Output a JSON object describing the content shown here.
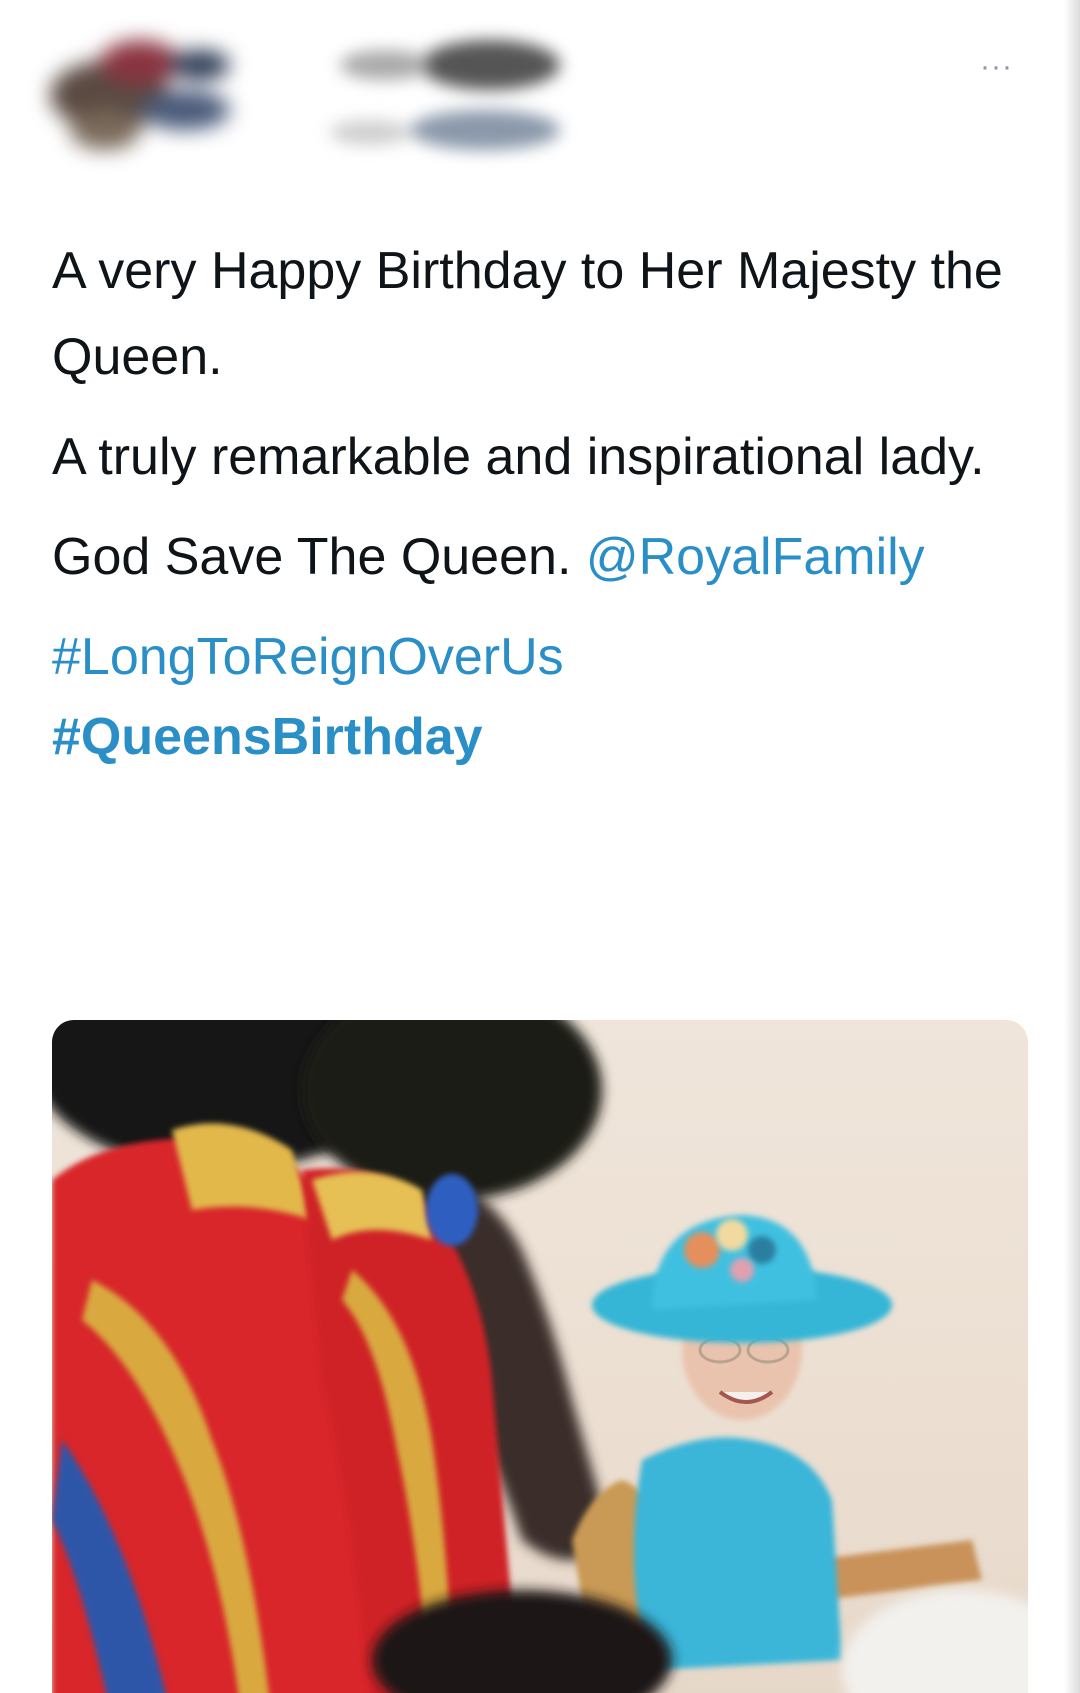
{
  "header": {
    "more_label": "···"
  },
  "tweet": {
    "line1": "A very Happy Birthday to Her Majesty the Queen.",
    "line2": "A truly remarkable and inspirational lady.",
    "line3_text": "God Save The Queen.",
    "mention": "@RoyalFamily",
    "hashtag1": "#LongToReignOverUs",
    "hashtag2": "#QueensBirthday"
  },
  "media": {
    "icon": "photo-image",
    "colors": {
      "tunic_red": "#d8262b",
      "hat_turquoise": "#35b6d6",
      "background_sand": "#ecdfd2"
    }
  },
  "colors": {
    "text": "#0f1419",
    "link": "#2a8fc7",
    "muted": "#8b98a5"
  }
}
